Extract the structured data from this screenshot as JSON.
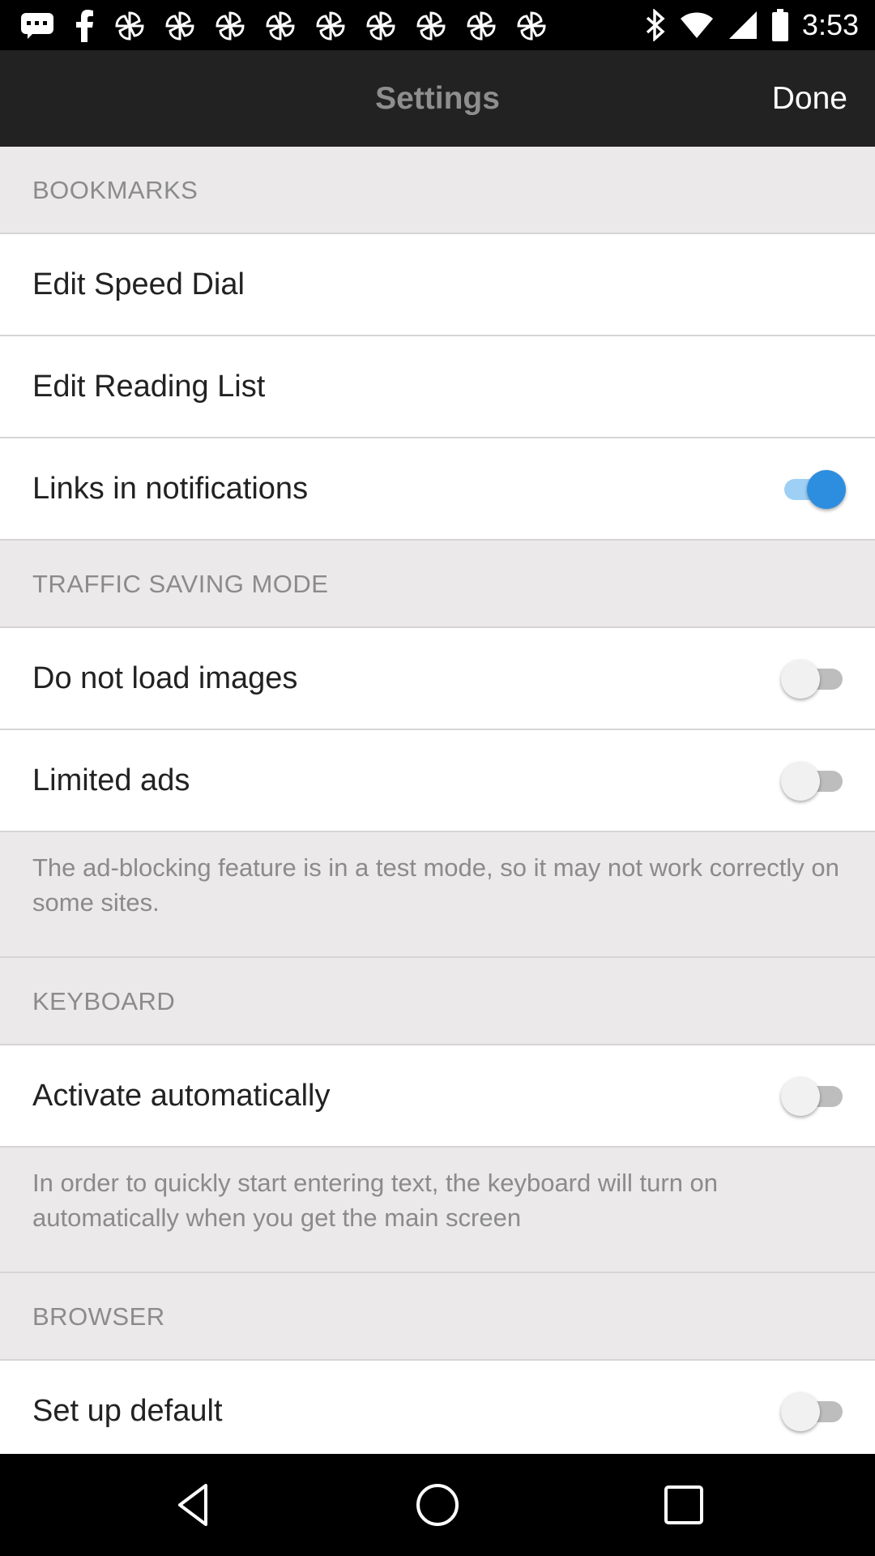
{
  "status_bar": {
    "time": "3:53",
    "icons": [
      "message-icon",
      "facebook-icon",
      "pinwheel-icon",
      "pinwheel-icon",
      "pinwheel-icon",
      "pinwheel-icon",
      "pinwheel-icon",
      "pinwheel-icon",
      "pinwheel-icon",
      "pinwheel-icon",
      "pinwheel-icon",
      "bluetooth-icon",
      "wifi-icon",
      "signal-icon",
      "battery-icon"
    ]
  },
  "app_bar": {
    "title": "Settings",
    "done_label": "Done"
  },
  "sections": {
    "bookmarks": {
      "header": "BOOKMARKS",
      "edit_speed_dial": "Edit Speed Dial",
      "edit_reading_list": "Edit Reading List",
      "links_in_notifications": "Links in notifications",
      "links_in_notifications_on": true
    },
    "traffic": {
      "header": "TRAFFIC SAVING MODE",
      "do_not_load_images": "Do not load images",
      "do_not_load_images_on": false,
      "limited_ads": "Limited ads",
      "limited_ads_on": false,
      "note": "The ad-blocking feature is in a test mode, so it may not work correctly on some sites."
    },
    "keyboard": {
      "header": "KEYBOARD",
      "activate_automatically": "Activate automatically",
      "activate_automatically_on": false,
      "note": "In order to quickly start entering text, the keyboard will turn on automatically when you get the main screen"
    },
    "browser": {
      "header": "BROWSER",
      "set_up_default": "Set up default",
      "set_up_default_on": false
    }
  },
  "nav_bar": {
    "icons": [
      "back-icon",
      "home-icon",
      "recents-icon"
    ]
  },
  "colors": {
    "accent": "#2d8ee0",
    "app_bar": "#222222",
    "background": "#ebe9e9"
  }
}
